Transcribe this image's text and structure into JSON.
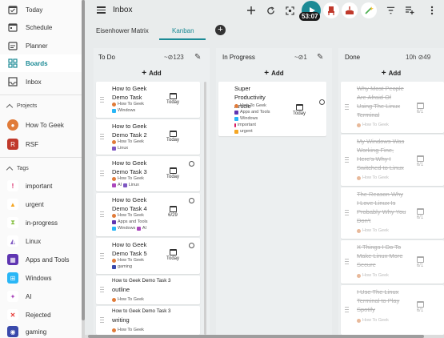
{
  "sidebar": {
    "nav": [
      {
        "label": "Today",
        "icon": "today-icon"
      },
      {
        "label": "Schedule",
        "icon": "schedule-icon"
      },
      {
        "label": "Planner",
        "icon": "planner-icon"
      },
      {
        "label": "Boards",
        "icon": "boards-icon"
      },
      {
        "label": "Inbox",
        "icon": "inbox-icon"
      }
    ],
    "projects_heading": "Projects",
    "projects": [
      {
        "label": "How To Geek",
        "color": "#e07b39"
      },
      {
        "label": "RSF",
        "color": "#c0392b"
      }
    ],
    "tags_heading": "Tags",
    "tags": [
      {
        "label": "important",
        "color": "#d81b60"
      },
      {
        "label": "urgent",
        "color": "#f5a623"
      },
      {
        "label": "in-progress",
        "color": "#8bc34a"
      },
      {
        "label": "Linux",
        "color": "#7e57c2"
      },
      {
        "label": "Apps and Tools",
        "color": "#5e35b1"
      },
      {
        "label": "Windows",
        "color": "#29b6f6"
      },
      {
        "label": "AI",
        "color": "#ab47bc"
      },
      {
        "label": "Rejected",
        "color": "#e53935"
      },
      {
        "label": "gaming",
        "color": "#3949ab"
      }
    ]
  },
  "header": {
    "title": "Inbox",
    "timer": "53:07",
    "accent": "#1b8a95"
  },
  "tabs": [
    {
      "label": "Eisenhower Matrix"
    },
    {
      "label": "Kanban"
    }
  ],
  "columns": {
    "todo": {
      "title": "To Do",
      "meta": "~⊘123",
      "add_label": "Add",
      "cards": [
        {
          "title": "How to Geek Demo Task",
          "tags": [
            "How To Geek",
            "Windows"
          ],
          "due": "Today"
        },
        {
          "title": "How to Geek Demo Task 2",
          "tags": [
            "How To Geek",
            "Linux"
          ],
          "due": "Today"
        },
        {
          "title": "How to Geek Demo Task 3",
          "tags": [
            "How To Geek",
            "AI",
            "Linux"
          ],
          "due": "Today"
        },
        {
          "title": "How to Geek Demo Task 4",
          "tags": [
            "How To Geek",
            "Apps and Tools",
            "Windows",
            "AI"
          ],
          "due": "6/29"
        },
        {
          "title": "How to Geek Demo Task 5",
          "tags": [
            "How To Geek",
            "gaming"
          ],
          "due": "Today"
        },
        {
          "title": "outline",
          "subtitle": "How to Geek Demo Task 3",
          "tags": [
            "How To Geek"
          ]
        },
        {
          "title": "writing",
          "subtitle": "How to Geek Demo Task 3",
          "tags": [
            "How To Geek"
          ]
        }
      ]
    },
    "progress": {
      "title": "In Progress",
      "meta": "~⊘1",
      "add_label": "Add",
      "cards": [
        {
          "title": "Super Productivity Article",
          "tags": [
            "How To Geek",
            "Apps and Tools",
            "Windows",
            "important",
            "urgent"
          ],
          "due": "Today"
        }
      ]
    },
    "done": {
      "title": "Done",
      "meta": "10h ⊘49",
      "add_label": "Add",
      "cards": [
        {
          "title": "Why Most People Are Afraid Of Using The Linux Terminal",
          "tags": [
            "How To Geek"
          ],
          "due": "6/1"
        },
        {
          "title": "My Windows Was Working Fine, Here's Why I Switched to Linux",
          "tags": [
            "How To Geek"
          ],
          "due": "6/1"
        },
        {
          "title": "The Reason Why I Love Linux Is Probably Why You Don't",
          "tags": [
            "How To Geek"
          ],
          "due": "6/1"
        },
        {
          "title": "X Things I Do To Make Linux More Secure",
          "tags": [
            "How To Geek"
          ],
          "due": "6/1"
        },
        {
          "title": "I Use The Linux Terminal to Play Spotify",
          "tags": [
            "How To Geek"
          ],
          "due": "6/1"
        }
      ]
    }
  }
}
